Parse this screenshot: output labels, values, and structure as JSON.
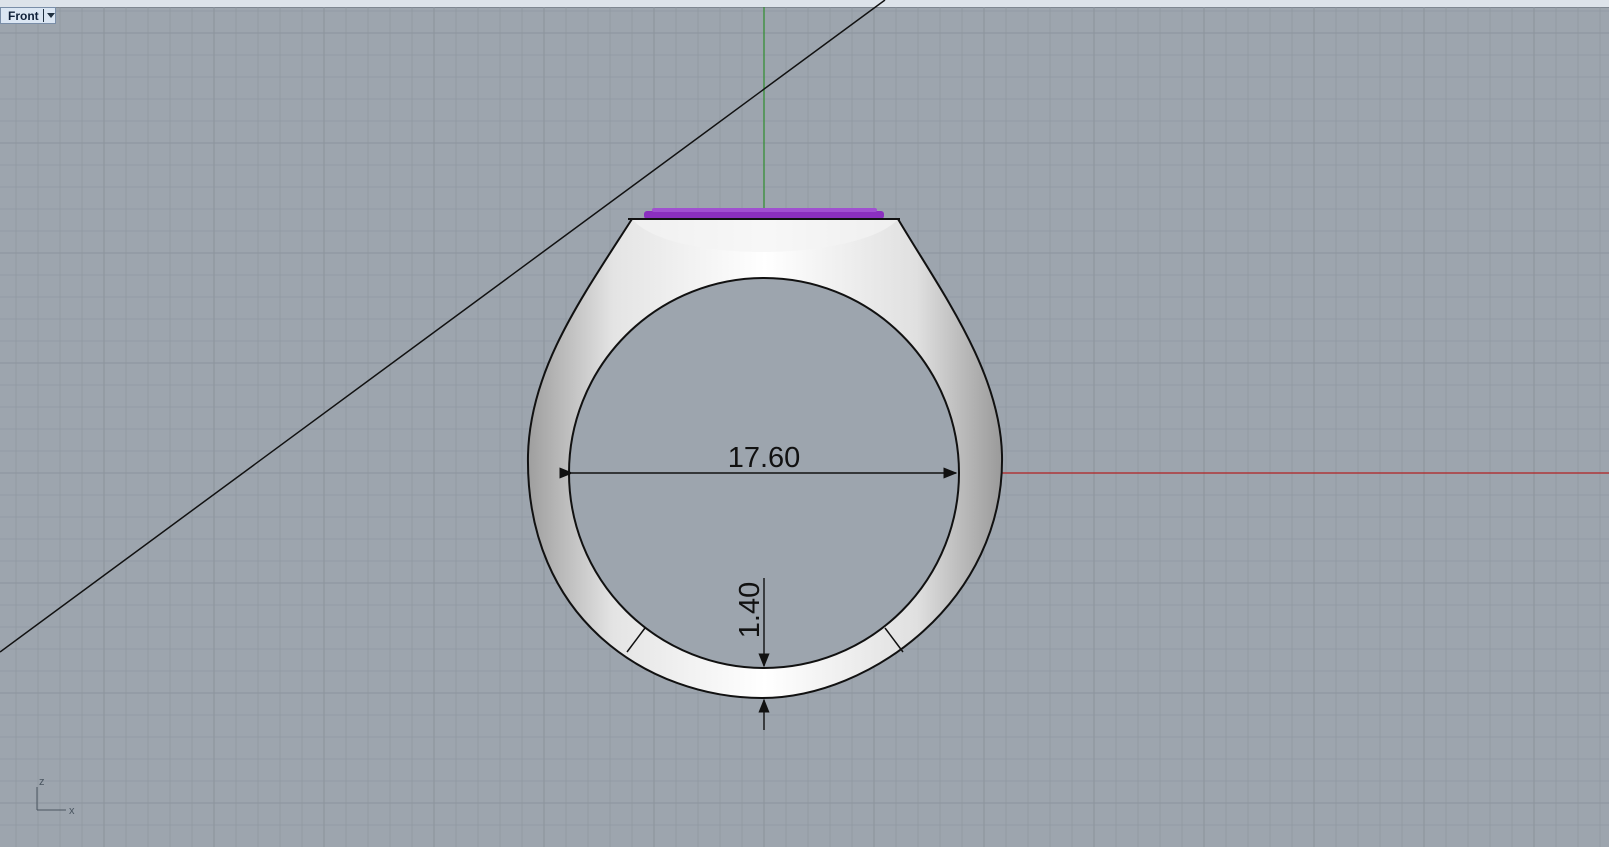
{
  "viewport": {
    "name": "Front",
    "background": "#9da5ae",
    "grid_color": "#8c949d",
    "x_axis_color": "#b22222",
    "z_axis_color": "#2f8f2f"
  },
  "dimensions": {
    "inner_diameter": "17.60",
    "thickness": "1.40"
  },
  "axis_indicator": {
    "vertical": "z",
    "horizontal": "x"
  },
  "colors": {
    "ring_metal": "#d7d7d7",
    "gem_pave": "#8b2fbf",
    "dimension_line": "#111111"
  }
}
